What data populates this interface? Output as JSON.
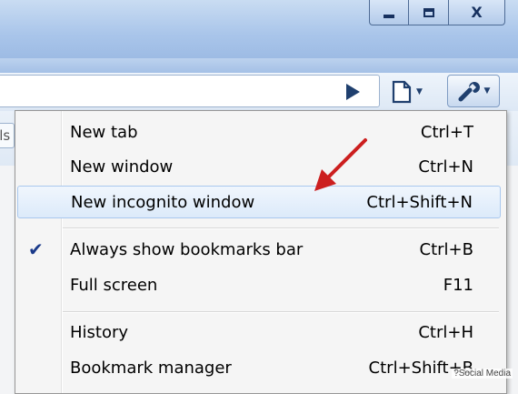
{
  "window": {
    "controls": {
      "minimize": "",
      "maximize": "",
      "close": "X"
    }
  },
  "toolbar": {
    "bookmark_stub_text": "els"
  },
  "menu": {
    "items": [
      {
        "label": "New tab",
        "shortcut": "Ctrl+T"
      },
      {
        "label": "New window",
        "shortcut": "Ctrl+N"
      },
      {
        "label": "New incognito window",
        "shortcut": "Ctrl+Shift+N",
        "highlighted": true
      },
      {
        "label": "Always show bookmarks bar",
        "shortcut": "Ctrl+B",
        "checked": true
      },
      {
        "label": "Full screen",
        "shortcut": "F11"
      },
      {
        "label": "History",
        "shortcut": "Ctrl+H"
      },
      {
        "label": "Bookmark manager",
        "shortcut": "Ctrl+Shift+B"
      }
    ],
    "check_glyph": "✔"
  },
  "annotation": {
    "arrow_color": "#cc1f1f"
  },
  "watermark": "?Social Media",
  "colors": {
    "titlebar": "#a9c5ea",
    "highlight": "#dceafa",
    "icon_blue": "#1f3f6e"
  },
  "icons": {
    "go": "play-triangle-icon",
    "page": "page-icon",
    "wrench": "wrench-icon"
  }
}
